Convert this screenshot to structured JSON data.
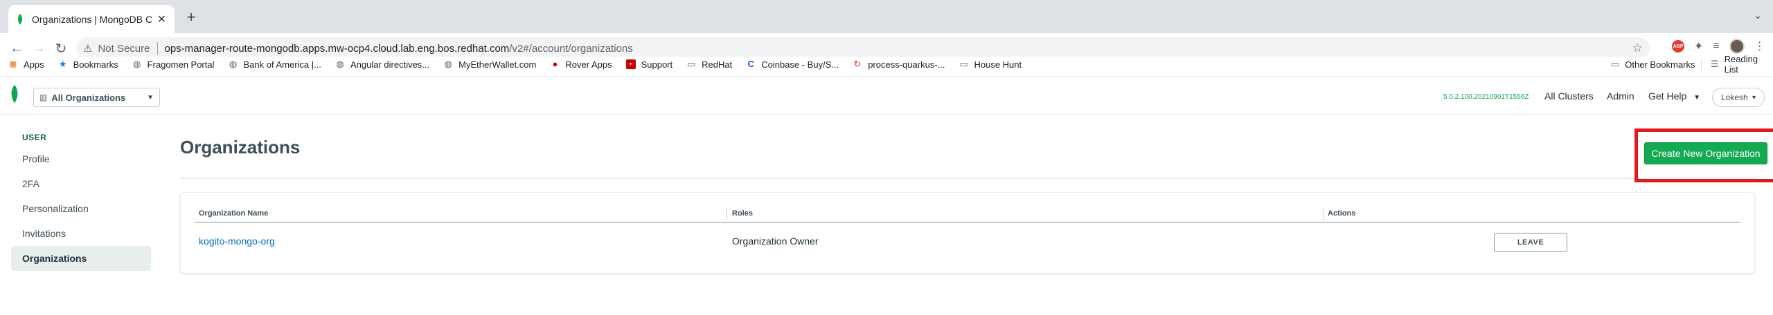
{
  "browser": {
    "tab_title": "Organizations | MongoDB Clou",
    "tab_close": "✕",
    "new_tab": "+",
    "tab_menu": "⌄",
    "back": "←",
    "forward": "→",
    "reload": "↻",
    "security_warning": "Not Secure",
    "url_host": "ops-manager-route-mongodb.apps.mw-ocp4.cloud.lab.eng.bos.redhat.com",
    "url_path": "/v2#/account/organizations",
    "extension_abp": "ABP"
  },
  "bookmarks": {
    "items": [
      {
        "label": "Apps",
        "icon": "apps-grid-icon"
      },
      {
        "label": "Bookmarks",
        "icon": "star-icon"
      },
      {
        "label": "Fragomen Portal",
        "icon": "globe-icon"
      },
      {
        "label": "Bank of America |...",
        "icon": "globe-icon"
      },
      {
        "label": "Angular directives...",
        "icon": "globe-icon"
      },
      {
        "label": "MyEtherWallet.com",
        "icon": "globe-icon"
      },
      {
        "label": "Rover Apps",
        "icon": "redhat-icon"
      },
      {
        "label": "Support",
        "icon": "support-icon"
      },
      {
        "label": "RedHat",
        "icon": "folder-icon"
      },
      {
        "label": "Coinbase - Buy/S...",
        "icon": "coinbase-icon"
      },
      {
        "label": "process-quarkus-...",
        "icon": "quarkus-icon"
      },
      {
        "label": "House Hunt",
        "icon": "folder-icon"
      }
    ],
    "other_bookmarks": "Other Bookmarks",
    "reading_list": "Reading List"
  },
  "appnav": {
    "org_selector": "All Organizations",
    "version": "5.0.2.100.20210901T1556Z",
    "all_clusters": "All Clusters",
    "admin": "Admin",
    "get_help": "Get Help",
    "user": "Lokesh"
  },
  "sidebar": {
    "header": "USER",
    "items": [
      {
        "label": "Profile"
      },
      {
        "label": "2FA"
      },
      {
        "label": "Personalization"
      },
      {
        "label": "Invitations"
      },
      {
        "label": "Organizations"
      }
    ]
  },
  "main": {
    "title": "Organizations",
    "create_button": "Create New Organization",
    "columns": [
      "Organization Name",
      "Roles",
      "Actions"
    ],
    "rows": [
      {
        "name": "kogito-mongo-org",
        "role": "Organization Owner",
        "action": "LEAVE"
      }
    ]
  },
  "colors": {
    "accent_green": "#13aa52",
    "highlight_red": "#e11b1b",
    "link_blue": "#006cbc"
  }
}
